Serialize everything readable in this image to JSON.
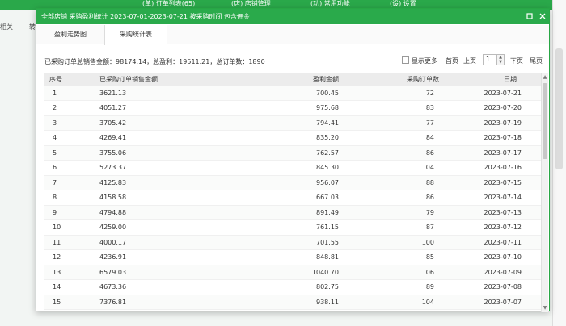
{
  "background": {
    "nav": [
      {
        "icon": "(单)",
        "label": "订单列表(65)"
      },
      {
        "icon": "(店)",
        "label": "店铺管理"
      },
      {
        "icon": "(功)",
        "label": "常用功能"
      },
      {
        "icon": "(设)",
        "label": "设置"
      }
    ],
    "left_text_1": "相关",
    "left_text_2": "转"
  },
  "dialog": {
    "title": "全部店铺 采购盈利统计 2023-07-01-2023-07-21 按采购时间 包含佣金",
    "minimize_icon": "square-icon",
    "close_icon": "close-icon",
    "tabs": [
      {
        "label": "盈利走势图",
        "active": false
      },
      {
        "label": "采购统计表",
        "active": true
      }
    ],
    "summary": "已采购订单总销售金额：98174.14，总盈利：19511.21，总订单数：1890",
    "pager": {
      "show_more": "显示更多",
      "first": "首页",
      "prev": "上页",
      "page": "1",
      "next": "下页",
      "last": "尾页"
    },
    "columns": [
      "序号",
      "已采购订单销售金额",
      "盈利金额",
      "采购订单数",
      "日期"
    ],
    "rows": [
      [
        "1",
        "3621.13",
        "700.45",
        "72",
        "2023-07-21"
      ],
      [
        "2",
        "4051.27",
        "975.68",
        "83",
        "2023-07-20"
      ],
      [
        "3",
        "3705.42",
        "794.41",
        "77",
        "2023-07-19"
      ],
      [
        "4",
        "4269.41",
        "835.20",
        "84",
        "2023-07-18"
      ],
      [
        "5",
        "3755.06",
        "762.57",
        "86",
        "2023-07-17"
      ],
      [
        "6",
        "5273.37",
        "845.30",
        "104",
        "2023-07-16"
      ],
      [
        "7",
        "4125.83",
        "956.07",
        "88",
        "2023-07-15"
      ],
      [
        "8",
        "4158.58",
        "667.03",
        "86",
        "2023-07-14"
      ],
      [
        "9",
        "4794.88",
        "891.49",
        "79",
        "2023-07-13"
      ],
      [
        "10",
        "4259.00",
        "761.15",
        "87",
        "2023-07-12"
      ],
      [
        "11",
        "4000.17",
        "701.55",
        "100",
        "2023-07-11"
      ],
      [
        "12",
        "4236.91",
        "848.81",
        "85",
        "2023-07-10"
      ],
      [
        "13",
        "6579.03",
        "1040.70",
        "106",
        "2023-07-09"
      ],
      [
        "14",
        "4673.36",
        "802.75",
        "89",
        "2023-07-08"
      ],
      [
        "15",
        "7376.81",
        "938.11",
        "104",
        "2023-07-07"
      ]
    ]
  },
  "colors": {
    "accent": "#2aaa4b",
    "header_bg": "#ececec"
  }
}
